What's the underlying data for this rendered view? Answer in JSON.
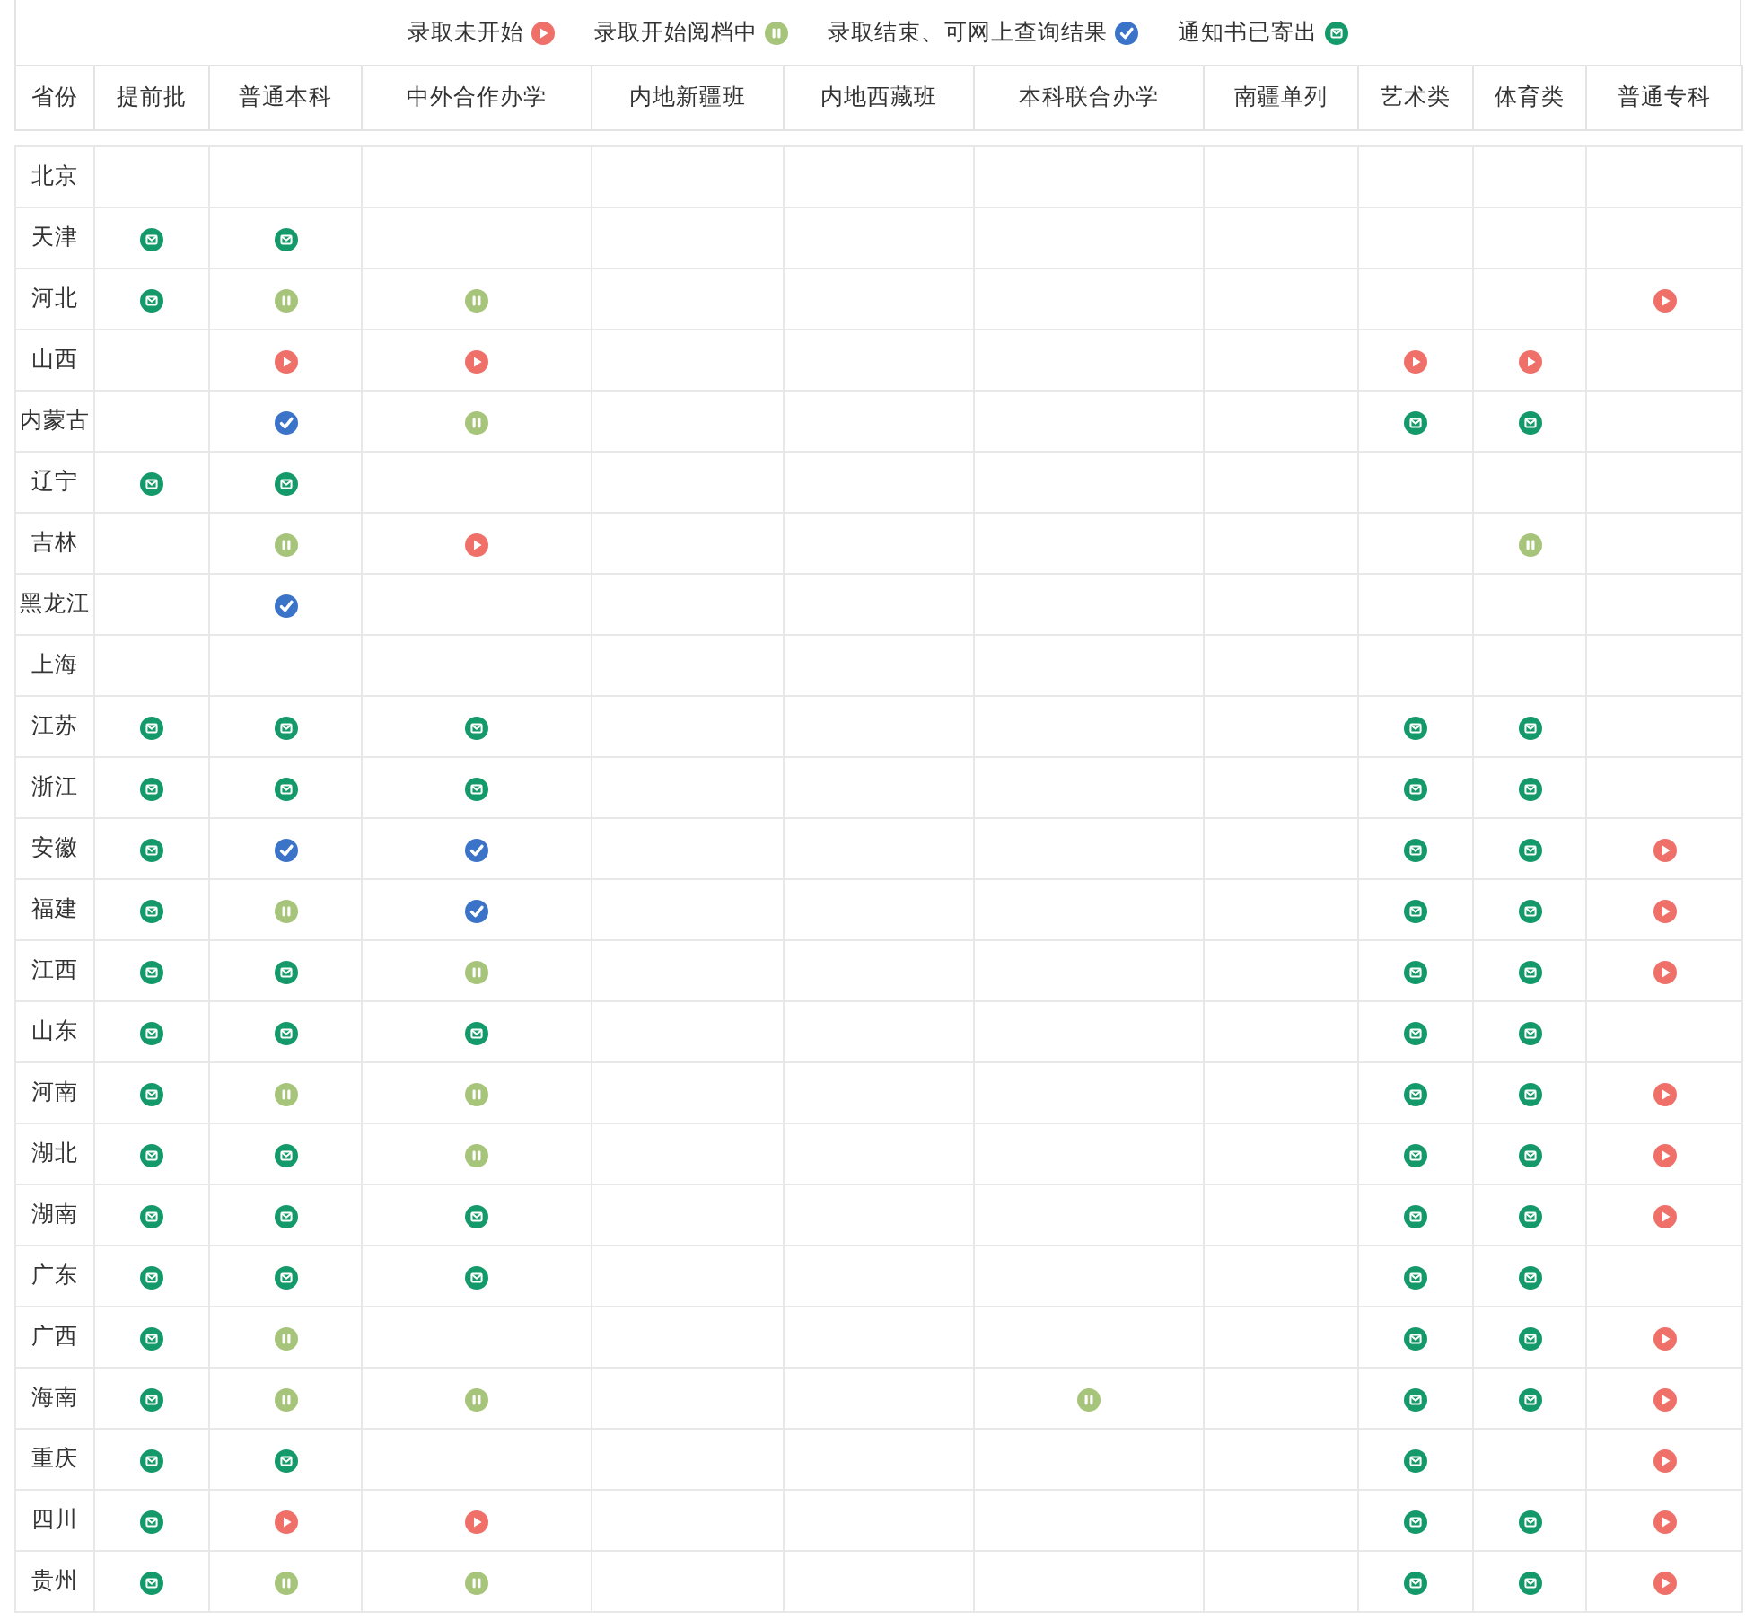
{
  "legend": [
    {
      "label": "录取未开始",
      "kind": "start"
    },
    {
      "label": "录取开始阅档中",
      "kind": "reading"
    },
    {
      "label": "录取结束、可网上查询结果",
      "kind": "done"
    },
    {
      "label": "通知书已寄出",
      "kind": "mailed"
    }
  ],
  "table": {
    "columns": [
      "省份",
      "提前批",
      "普通本科",
      "中外合作办学",
      "内地新疆班",
      "内地西藏班",
      "本科联合办学",
      "南疆单列",
      "艺术类",
      "体育类",
      "普通专科"
    ],
    "rows": [
      {
        "province": "北京",
        "cells": [
          null,
          null,
          null,
          null,
          null,
          null,
          null,
          null,
          null,
          null
        ]
      },
      {
        "province": "天津",
        "cells": [
          {
            "kind": "mailed"
          },
          {
            "kind": "mailed"
          },
          null,
          null,
          null,
          null,
          null,
          null,
          null,
          null
        ]
      },
      {
        "province": "河北",
        "cells": [
          {
            "kind": "mailed"
          },
          {
            "kind": "reading"
          },
          {
            "kind": "reading"
          },
          null,
          null,
          null,
          null,
          null,
          null,
          {
            "kind": "start"
          }
        ]
      },
      {
        "province": "山西",
        "cells": [
          null,
          {
            "kind": "start"
          },
          {
            "kind": "start"
          },
          null,
          null,
          null,
          null,
          {
            "kind": "start"
          },
          {
            "kind": "start"
          },
          null
        ]
      },
      {
        "province": "内蒙古",
        "cells": [
          null,
          {
            "kind": "done"
          },
          {
            "kind": "reading"
          },
          null,
          null,
          null,
          null,
          {
            "kind": "mailed"
          },
          {
            "kind": "mailed"
          },
          null
        ]
      },
      {
        "province": "辽宁",
        "cells": [
          {
            "kind": "mailed"
          },
          {
            "kind": "mailed"
          },
          null,
          null,
          null,
          null,
          null,
          null,
          null,
          null
        ]
      },
      {
        "province": "吉林",
        "cells": [
          null,
          {
            "kind": "reading"
          },
          {
            "kind": "start"
          },
          null,
          null,
          null,
          null,
          null,
          {
            "kind": "reading"
          },
          null
        ]
      },
      {
        "province": "黑龙江",
        "cells": [
          null,
          {
            "kind": "done"
          },
          null,
          null,
          null,
          null,
          null,
          null,
          null,
          null
        ]
      },
      {
        "province": "上海",
        "cells": [
          null,
          null,
          null,
          null,
          null,
          null,
          null,
          null,
          null,
          null
        ]
      },
      {
        "province": "江苏",
        "cells": [
          {
            "kind": "mailed"
          },
          {
            "kind": "mailed"
          },
          {
            "kind": "mailed"
          },
          null,
          null,
          null,
          null,
          {
            "kind": "mailed"
          },
          {
            "kind": "mailed"
          },
          null
        ]
      },
      {
        "province": "浙江",
        "cells": [
          {
            "kind": "mailed"
          },
          {
            "kind": "mailed"
          },
          {
            "kind": "mailed"
          },
          null,
          null,
          null,
          null,
          {
            "kind": "mailed"
          },
          {
            "kind": "mailed"
          },
          null
        ]
      },
      {
        "province": "安徽",
        "cells": [
          {
            "kind": "mailed"
          },
          {
            "kind": "done"
          },
          {
            "kind": "done"
          },
          null,
          null,
          null,
          null,
          {
            "kind": "mailed"
          },
          {
            "kind": "mailed"
          },
          {
            "kind": "start"
          }
        ]
      },
      {
        "province": "福建",
        "cells": [
          {
            "kind": "mailed"
          },
          {
            "kind": "reading"
          },
          {
            "kind": "done"
          },
          null,
          null,
          null,
          null,
          {
            "kind": "mailed"
          },
          {
            "kind": "mailed"
          },
          {
            "kind": "start"
          }
        ]
      },
      {
        "province": "江西",
        "cells": [
          {
            "kind": "mailed"
          },
          {
            "kind": "mailed"
          },
          {
            "kind": "reading"
          },
          null,
          null,
          null,
          null,
          {
            "kind": "mailed"
          },
          {
            "kind": "mailed"
          },
          {
            "kind": "start"
          }
        ]
      },
      {
        "province": "山东",
        "cells": [
          {
            "kind": "mailed"
          },
          {
            "kind": "mailed"
          },
          {
            "kind": "mailed"
          },
          null,
          null,
          null,
          null,
          {
            "kind": "mailed"
          },
          {
            "kind": "mailed"
          },
          null
        ]
      },
      {
        "province": "河南",
        "cells": [
          {
            "kind": "mailed"
          },
          {
            "kind": "reading"
          },
          {
            "kind": "reading"
          },
          null,
          null,
          null,
          null,
          {
            "kind": "mailed"
          },
          {
            "kind": "mailed"
          },
          {
            "kind": "start"
          }
        ]
      },
      {
        "province": "湖北",
        "cells": [
          {
            "kind": "mailed"
          },
          {
            "kind": "mailed"
          },
          {
            "kind": "reading"
          },
          null,
          null,
          null,
          null,
          {
            "kind": "mailed"
          },
          {
            "kind": "mailed"
          },
          {
            "kind": "start"
          }
        ]
      },
      {
        "province": "湖南",
        "cells": [
          {
            "kind": "mailed"
          },
          {
            "kind": "mailed"
          },
          {
            "kind": "mailed"
          },
          null,
          null,
          null,
          null,
          {
            "kind": "mailed"
          },
          {
            "kind": "mailed"
          },
          {
            "kind": "start"
          }
        ]
      },
      {
        "province": "广东",
        "cells": [
          {
            "kind": "mailed"
          },
          {
            "kind": "mailed"
          },
          {
            "kind": "mailed"
          },
          null,
          null,
          null,
          null,
          {
            "kind": "mailed"
          },
          {
            "kind": "mailed"
          },
          null
        ]
      },
      {
        "province": "广西",
        "cells": [
          {
            "kind": "mailed"
          },
          {
            "kind": "reading"
          },
          null,
          null,
          null,
          null,
          null,
          {
            "kind": "mailed"
          },
          {
            "kind": "mailed"
          },
          {
            "kind": "start"
          }
        ]
      },
      {
        "province": "海南",
        "cells": [
          {
            "kind": "mailed"
          },
          {
            "kind": "reading"
          },
          {
            "kind": "reading"
          },
          null,
          null,
          {
            "kind": "reading"
          },
          null,
          {
            "kind": "mailed"
          },
          {
            "kind": "mailed"
          },
          {
            "kind": "start"
          }
        ]
      },
      {
        "province": "重庆",
        "cells": [
          {
            "kind": "mailed"
          },
          {
            "kind": "mailed"
          },
          null,
          null,
          null,
          null,
          null,
          {
            "kind": "mailed"
          },
          null,
          {
            "kind": "start"
          }
        ]
      },
      {
        "province": "四川",
        "cells": [
          {
            "kind": "mailed"
          },
          {
            "kind": "start"
          },
          {
            "kind": "start"
          },
          null,
          null,
          null,
          null,
          {
            "kind": "mailed"
          },
          {
            "kind": "mailed"
          },
          {
            "kind": "start"
          }
        ]
      },
      {
        "province": "贵州",
        "cells": [
          {
            "kind": "mailed"
          },
          {
            "kind": "reading"
          },
          {
            "kind": "reading"
          },
          null,
          null,
          null,
          null,
          {
            "kind": "mailed"
          },
          {
            "kind": "mailed"
          },
          {
            "kind": "start"
          }
        ]
      }
    ]
  }
}
